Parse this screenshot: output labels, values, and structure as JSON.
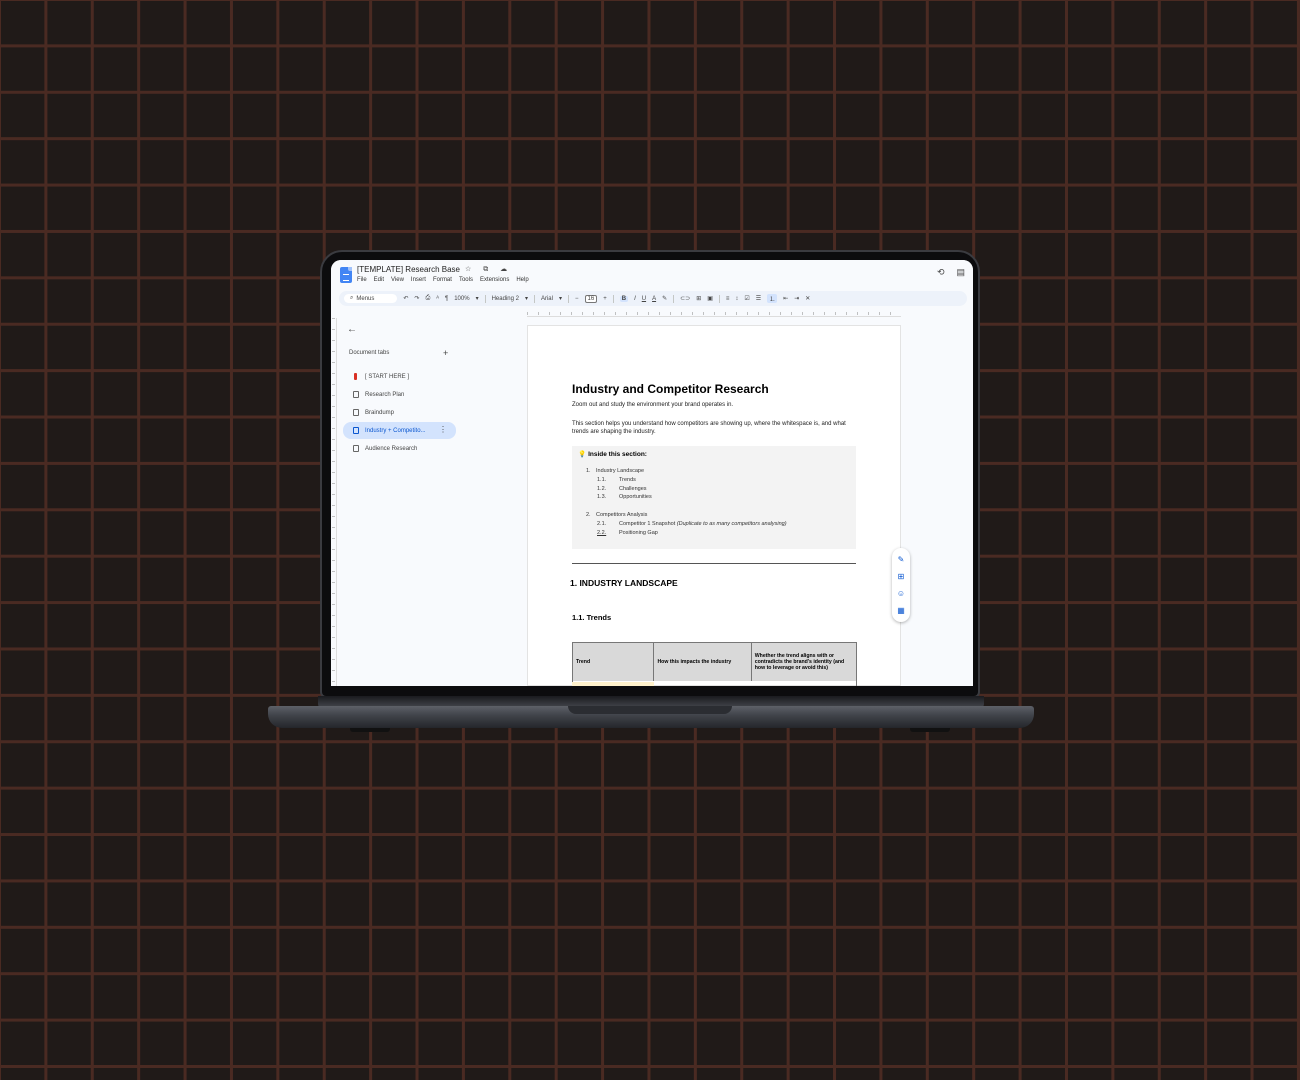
{
  "doc": {
    "title": "[TEMPLATE] Research Base",
    "title_icons": "☆ ⧉ ☁",
    "menus": [
      "File",
      "Edit",
      "View",
      "Insert",
      "Format",
      "Tools",
      "Extensions",
      "Help"
    ],
    "history_icon": "⟲",
    "comment_icon": "▤"
  },
  "toolbar": {
    "menus_label": "Menus",
    "undo": "↶",
    "redo": "↷",
    "print": "⎙",
    "spell": "ᴬ",
    "paint_format": "¶",
    "zoom": "100%",
    "style": "Heading 2",
    "font": "Arial",
    "minus": "−",
    "font_size": "16",
    "plus": "+",
    "bold": "B",
    "italic": "I",
    "underline": "U",
    "text_color": "A",
    "highlight": "✎",
    "link": "⊂⊃",
    "comment": "⊞",
    "image": "▣",
    "align": "≡",
    "line_spacing": "↕",
    "checklist": "☑",
    "bullets": "☰",
    "numbered": "⒈",
    "indent_less": "⇤",
    "indent_more": "⇥",
    "clear": "✕"
  },
  "sidebar": {
    "back": "←",
    "header": "Document tabs",
    "add": "+",
    "items": [
      {
        "label": "[ START HERE ]"
      },
      {
        "label": "Research Plan"
      },
      {
        "label": "Braindump"
      },
      {
        "label": "Industry + Competito..."
      },
      {
        "label": "Audience Research"
      }
    ],
    "kebab": "⋮"
  },
  "page": {
    "heading": "Industry and Competitor Research",
    "intro": "Zoom out and study the environment your brand operates in.",
    "body": "This section helps you understand how competitors are showing up, where the whitespace is, and what trends are shaping the industry.",
    "callout": {
      "icon": "💡",
      "title": "Inside this section:",
      "toc": [
        {
          "num": "1.",
          "label": "Industry Landscape"
        },
        {
          "num": "1.1.",
          "label": "Trends"
        },
        {
          "num": "1.2.",
          "label": "Challenges"
        },
        {
          "num": "1.3.",
          "label": "Opportunities"
        },
        {
          "num": "2.",
          "label": "Competitors Analysis"
        },
        {
          "num": "2.1.",
          "label": "Competitor 1 Snapshot",
          "note": "(Duplicate to as many competitors analysing)"
        },
        {
          "num": "2.2.",
          "label": "Positioning Gap"
        }
      ]
    },
    "section1": "1.  INDUSTRY LANDSCAPE",
    "section1_1": "1.1.   Trends",
    "table": {
      "headers": [
        "Trend",
        "How this impacts the industry",
        "Whether the trend aligns with or contradicts the brand's identity (and how to leverage or avoid this)"
      ]
    }
  },
  "float_panel": {
    "edit": "✎",
    "add_comment": "⊞",
    "emoji": "☺",
    "suggest": "▦"
  }
}
